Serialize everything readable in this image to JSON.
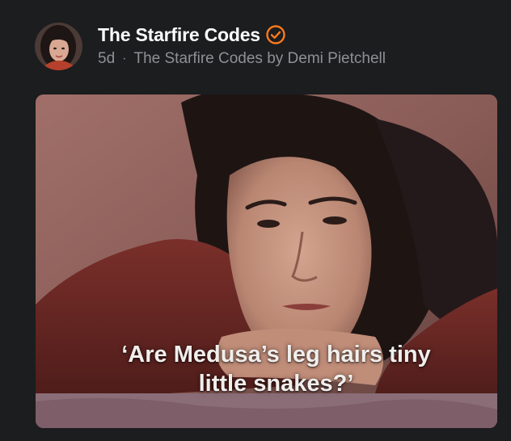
{
  "post": {
    "author": {
      "name": "The Starfire Codes",
      "verified": true,
      "avatar_icon": "avatar-woman-dark-hair"
    },
    "age": "5d",
    "separator": "·",
    "publication": "The Starfire Codes by Demi Pietchell",
    "media": {
      "caption_line1": "‘Are Medusa’s leg hairs tiny",
      "caption_line2": "little snakes?’"
    }
  },
  "colors": {
    "background": "#1b1d1f",
    "verified_badge": "#ff7a1a",
    "meta_text": "#8e9194"
  }
}
